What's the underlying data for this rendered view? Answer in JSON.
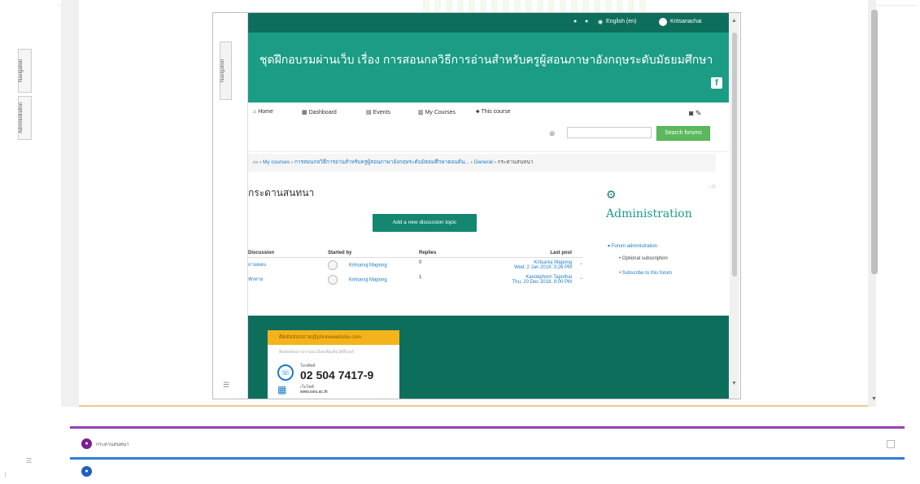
{
  "left_rail": {
    "tabs": [
      "Navigation",
      "Administration"
    ]
  },
  "iframe": {
    "side_tab_label": "Navigation",
    "topbar": {
      "bell_icon": "bell-icon",
      "chat_icon": "chat-icon",
      "language": "English (en)",
      "user": "Kritsanachai"
    },
    "banner": {
      "title": "ชุดฝึกอบรมผ่านเว็บ เรื่อง การสอนกลวิธีการอ่านสำหรับครูผู้สอนภาษาอังกฤษระดับมัธยมศึกษา",
      "facebook_glyph": "f"
    },
    "nav": {
      "items": [
        "Home",
        "Dashboard",
        "Events",
        "My Courses",
        "This course"
      ],
      "search_placeholder": "",
      "search_button": "Search forums"
    },
    "breadcrumb": {
      "items": [
        "My courses",
        "การสอนกลวิธีการอ่านสำหรับครูผู้สอนภาษาอังกฤษระดับมัธยมศึกษาตอนต้น...",
        "General",
        "กระดานสนทนา"
      ]
    },
    "page_title": "กระดานสนทนา",
    "add_topic_button": "Add a new discussion topic",
    "table": {
      "headers": [
        "Discussion",
        "Started by",
        "Replies",
        "Last post"
      ],
      "rows": [
        {
          "discussion": "ถามตอบ",
          "started_by": "Kritsanuj Mapong",
          "replies": "0",
          "last_post_author": "Kritsanuj Mapong",
          "last_post_date": "Wed, 2 Jan 2019, 3:26 PM"
        },
        {
          "discussion": "ทักทาย",
          "started_by": "Kritsanuj Mapong",
          "replies": "1",
          "last_post_author": "Kanokphorn Tapothai",
          "last_post_date": "Thu, 20 Dec 2018, 9:00 PM"
        }
      ]
    },
    "admin": {
      "collapse": "- □",
      "heading": "Administration",
      "forum_admin": "Forum administration",
      "items": [
        "Optional subscription",
        "Subscribe to this forum"
      ]
    },
    "promo": {
      "header": "ติดต่อสอบถาม@phonewebsite.com",
      "subline": "ติดต่อสอบถามรายละเอียดเพิ่มเติมได้ที่เบอร์",
      "phone_label": "โทรศัพท์",
      "phone": "02 504 7417-9",
      "web_label": "เว็บไซต์",
      "web_value": "www.ssru.ac.th"
    }
  },
  "sections": [
    {
      "label": "กระดานสนทนา",
      "color": "#9b3fb5"
    },
    {
      "label": "",
      "color": "#2f7fd3"
    }
  ]
}
